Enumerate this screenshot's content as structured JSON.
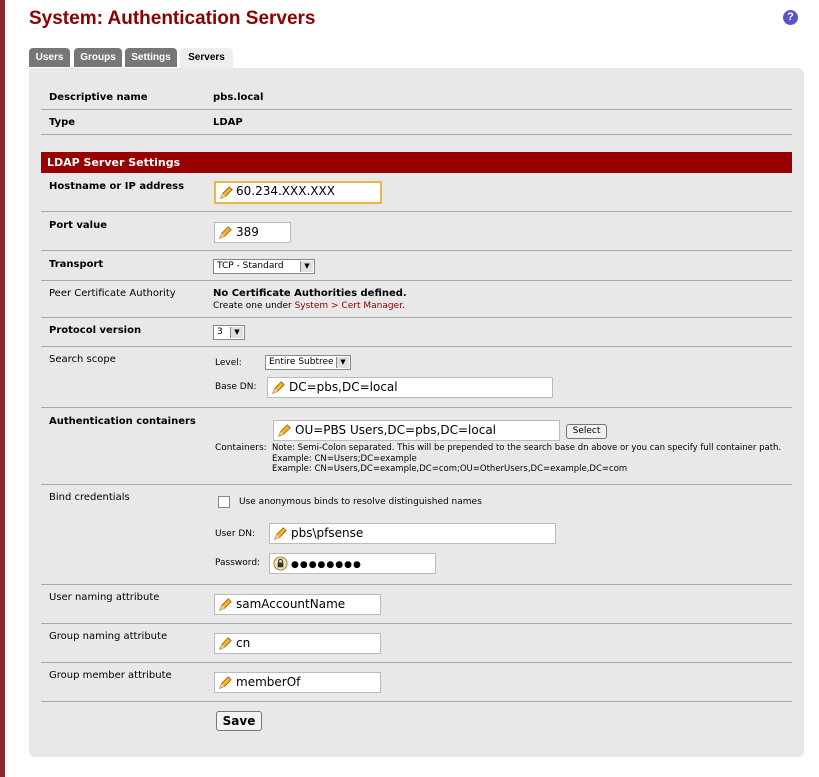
{
  "page": {
    "title": "System: Authentication Servers",
    "help_icon": "help-icon",
    "help_glyph": "?"
  },
  "tabs": [
    {
      "label": "Users"
    },
    {
      "label": "Groups"
    },
    {
      "label": "Settings"
    },
    {
      "label": "Servers",
      "active": true
    }
  ],
  "general": {
    "descriptive_name_label": "Descriptive name",
    "descriptive_name_value": "pbs.local",
    "type_label": "Type",
    "type_value": "LDAP"
  },
  "ldap": {
    "section_title": "LDAP Server Settings",
    "hostname_label": "Hostname or IP address",
    "hostname_value": "60.234.XXX.XXX",
    "port_label": "Port value",
    "port_value": "389",
    "transport_label": "Transport",
    "transport_value": "TCP - Standard",
    "peer_ca_label": "Peer Certificate Authority",
    "peer_ca_notice": "No Certificate Authorities defined.",
    "peer_ca_create_prefix": "Create one under ",
    "peer_ca_create_link": "System > Cert Manager",
    "peer_ca_create_suffix": ".",
    "protocol_label": "Protocol version",
    "protocol_value": "3",
    "search_scope_label": "Search scope",
    "level_label": "Level:",
    "level_value": "Entire Subtree",
    "base_dn_label": "Base DN:",
    "base_dn_value": "DC=pbs,DC=local",
    "auth_containers_label": "Authentication containers",
    "containers_label": "Containers:",
    "containers_value": "OU=PBS Users,DC=pbs,DC=local",
    "select_button": "Select",
    "containers_note1": "Note: Semi-Colon separated. This will be prepended to the search base dn above or you can specify full container path.",
    "containers_note2": "Example: CN=Users;DC=example",
    "containers_note3": "Example: CN=Users,DC=example,DC=com;OU=OtherUsers,DC=example,DC=com",
    "bind_label": "Bind credentials",
    "anon_bind_label": "Use anonymous binds to resolve distinguished names",
    "anon_bind_checked": false,
    "user_dn_label": "User DN:",
    "user_dn_value": "pbs\\pfsense",
    "password_label": "Password:",
    "password_value": "●●●●●●●●",
    "user_naming_label": "User naming attribute",
    "user_naming_value": "samAccountName",
    "group_naming_label": "Group naming attribute",
    "group_naming_value": "cn",
    "group_member_label": "Group member attribute",
    "group_member_value": "memberOf"
  },
  "actions": {
    "save_label": "Save"
  },
  "colors": {
    "title": "#8b0000",
    "section_header": "#990000",
    "focus_border": "#e8b84a"
  }
}
